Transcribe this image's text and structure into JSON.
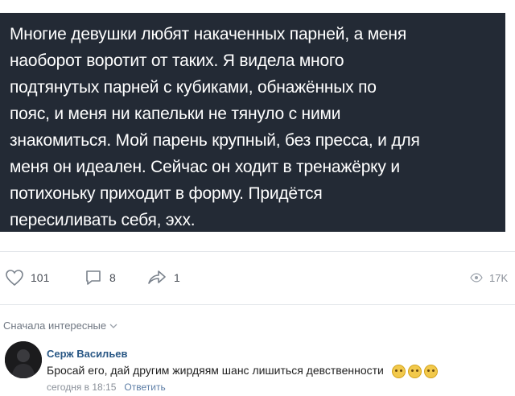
{
  "post": {
    "text": "Многие девушки любят накаченных парней, а меня\nнаоборот воротит от таких. Я видела много\nподтянутых парней с кубиками, обнажённых по\nпояс, и меня ни капельки не тянуло с ними\nзнакомиться. Мой парень крупный, без пресса, и для\nменя он идеален. Сейчас он ходит в тренажёрку и\nпотихоньку приходит в форму. Придётся\nпересиливать себя, эхх.",
    "background": "#232a35"
  },
  "actions": {
    "likes": "101",
    "comments": "8",
    "shares": "1",
    "views": "17K",
    "icons": [
      "heart-icon",
      "comment-icon",
      "share-icon",
      "eye-icon"
    ]
  },
  "comments": {
    "sort_label": "Сначала интересные",
    "items": [
      {
        "author": "Серж Васильев",
        "text": "Бросай его, дай другим жирдяям шанс лишиться девственности",
        "emoji_count": 3,
        "time": "сегодня в 18:15",
        "reply_label": "Ответить"
      }
    ]
  },
  "colors": {
    "author_link": "#2a5885",
    "muted": "#8a9099"
  }
}
